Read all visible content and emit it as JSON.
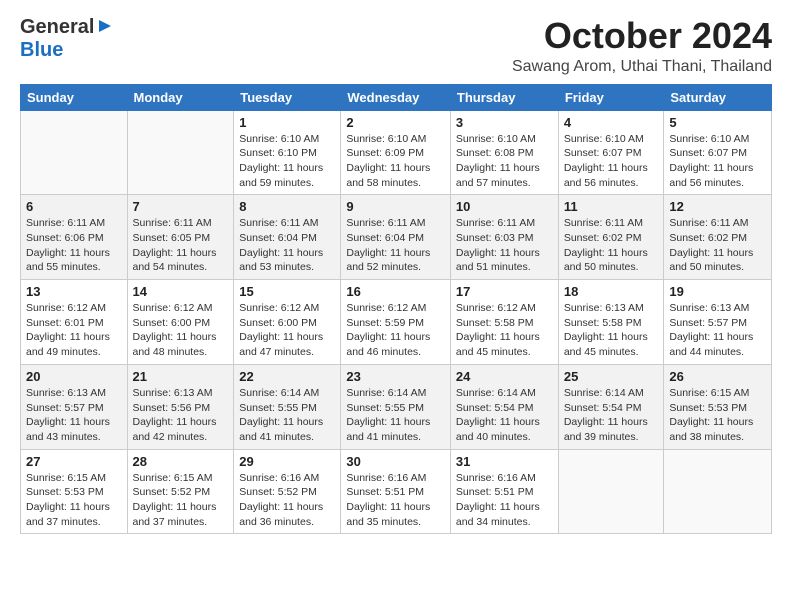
{
  "logo": {
    "general": "General",
    "blue": "Blue",
    "triangle": "▶"
  },
  "header": {
    "month": "October 2024",
    "location": "Sawang Arom, Uthai Thani, Thailand"
  },
  "weekdays": [
    "Sunday",
    "Monday",
    "Tuesday",
    "Wednesday",
    "Thursday",
    "Friday",
    "Saturday"
  ],
  "weeks": [
    [
      {
        "day": "",
        "content": ""
      },
      {
        "day": "",
        "content": ""
      },
      {
        "day": "1",
        "content": "Sunrise: 6:10 AM\nSunset: 6:10 PM\nDaylight: 11 hours and 59 minutes."
      },
      {
        "day": "2",
        "content": "Sunrise: 6:10 AM\nSunset: 6:09 PM\nDaylight: 11 hours and 58 minutes."
      },
      {
        "day": "3",
        "content": "Sunrise: 6:10 AM\nSunset: 6:08 PM\nDaylight: 11 hours and 57 minutes."
      },
      {
        "day": "4",
        "content": "Sunrise: 6:10 AM\nSunset: 6:07 PM\nDaylight: 11 hours and 56 minutes."
      },
      {
        "day": "5",
        "content": "Sunrise: 6:10 AM\nSunset: 6:07 PM\nDaylight: 11 hours and 56 minutes."
      }
    ],
    [
      {
        "day": "6",
        "content": "Sunrise: 6:11 AM\nSunset: 6:06 PM\nDaylight: 11 hours and 55 minutes."
      },
      {
        "day": "7",
        "content": "Sunrise: 6:11 AM\nSunset: 6:05 PM\nDaylight: 11 hours and 54 minutes."
      },
      {
        "day": "8",
        "content": "Sunrise: 6:11 AM\nSunset: 6:04 PM\nDaylight: 11 hours and 53 minutes."
      },
      {
        "day": "9",
        "content": "Sunrise: 6:11 AM\nSunset: 6:04 PM\nDaylight: 11 hours and 52 minutes."
      },
      {
        "day": "10",
        "content": "Sunrise: 6:11 AM\nSunset: 6:03 PM\nDaylight: 11 hours and 51 minutes."
      },
      {
        "day": "11",
        "content": "Sunrise: 6:11 AM\nSunset: 6:02 PM\nDaylight: 11 hours and 50 minutes."
      },
      {
        "day": "12",
        "content": "Sunrise: 6:11 AM\nSunset: 6:02 PM\nDaylight: 11 hours and 50 minutes."
      }
    ],
    [
      {
        "day": "13",
        "content": "Sunrise: 6:12 AM\nSunset: 6:01 PM\nDaylight: 11 hours and 49 minutes."
      },
      {
        "day": "14",
        "content": "Sunrise: 6:12 AM\nSunset: 6:00 PM\nDaylight: 11 hours and 48 minutes."
      },
      {
        "day": "15",
        "content": "Sunrise: 6:12 AM\nSunset: 6:00 PM\nDaylight: 11 hours and 47 minutes."
      },
      {
        "day": "16",
        "content": "Sunrise: 6:12 AM\nSunset: 5:59 PM\nDaylight: 11 hours and 46 minutes."
      },
      {
        "day": "17",
        "content": "Sunrise: 6:12 AM\nSunset: 5:58 PM\nDaylight: 11 hours and 45 minutes."
      },
      {
        "day": "18",
        "content": "Sunrise: 6:13 AM\nSunset: 5:58 PM\nDaylight: 11 hours and 45 minutes."
      },
      {
        "day": "19",
        "content": "Sunrise: 6:13 AM\nSunset: 5:57 PM\nDaylight: 11 hours and 44 minutes."
      }
    ],
    [
      {
        "day": "20",
        "content": "Sunrise: 6:13 AM\nSunset: 5:57 PM\nDaylight: 11 hours and 43 minutes."
      },
      {
        "day": "21",
        "content": "Sunrise: 6:13 AM\nSunset: 5:56 PM\nDaylight: 11 hours and 42 minutes."
      },
      {
        "day": "22",
        "content": "Sunrise: 6:14 AM\nSunset: 5:55 PM\nDaylight: 11 hours and 41 minutes."
      },
      {
        "day": "23",
        "content": "Sunrise: 6:14 AM\nSunset: 5:55 PM\nDaylight: 11 hours and 41 minutes."
      },
      {
        "day": "24",
        "content": "Sunrise: 6:14 AM\nSunset: 5:54 PM\nDaylight: 11 hours and 40 minutes."
      },
      {
        "day": "25",
        "content": "Sunrise: 6:14 AM\nSunset: 5:54 PM\nDaylight: 11 hours and 39 minutes."
      },
      {
        "day": "26",
        "content": "Sunrise: 6:15 AM\nSunset: 5:53 PM\nDaylight: 11 hours and 38 minutes."
      }
    ],
    [
      {
        "day": "27",
        "content": "Sunrise: 6:15 AM\nSunset: 5:53 PM\nDaylight: 11 hours and 37 minutes."
      },
      {
        "day": "28",
        "content": "Sunrise: 6:15 AM\nSunset: 5:52 PM\nDaylight: 11 hours and 37 minutes."
      },
      {
        "day": "29",
        "content": "Sunrise: 6:16 AM\nSunset: 5:52 PM\nDaylight: 11 hours and 36 minutes."
      },
      {
        "day": "30",
        "content": "Sunrise: 6:16 AM\nSunset: 5:51 PM\nDaylight: 11 hours and 35 minutes."
      },
      {
        "day": "31",
        "content": "Sunrise: 6:16 AM\nSunset: 5:51 PM\nDaylight: 11 hours and 34 minutes."
      },
      {
        "day": "",
        "content": ""
      },
      {
        "day": "",
        "content": ""
      }
    ]
  ]
}
